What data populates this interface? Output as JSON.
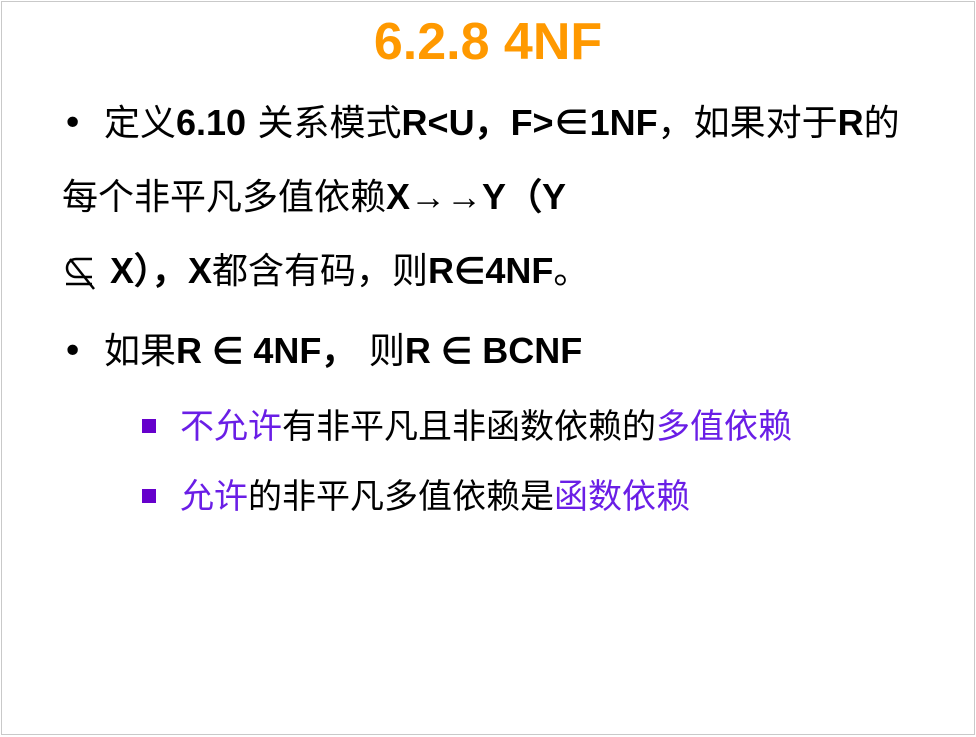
{
  "slide": {
    "title": "6.2.8  4NF",
    "bullet1": {
      "marker": "•",
      "p1": "定义",
      "p2": "6.10",
      "p3": "   关系模式",
      "p4": "R<U，F>∈1NF",
      "p5": "，如果对于",
      "p6": "R",
      "p7": "的每个非平凡多值依赖",
      "p8": "X→→Y（Y",
      "p9": " X），X",
      "p10": "都含有码，则",
      "p11": "R∈4NF",
      "p12": "。"
    },
    "bullet2": {
      "marker": "•",
      "p1": "如果",
      "p2": "R ∈ 4NF，",
      "p3": " 则",
      "p4": "R ∈ BCNF"
    },
    "sub1": {
      "hl1": "不允许",
      "mid": "有非平凡且非函数依赖的",
      "hl2": "多值依赖"
    },
    "sub2": {
      "hl1": "允许",
      "mid": "的非平凡多值依赖是",
      "hl2": "函数依赖"
    },
    "colors": {
      "title": "#ff9900",
      "highlight": "#6a1ee6",
      "square_bullet": "#6600cc"
    }
  }
}
